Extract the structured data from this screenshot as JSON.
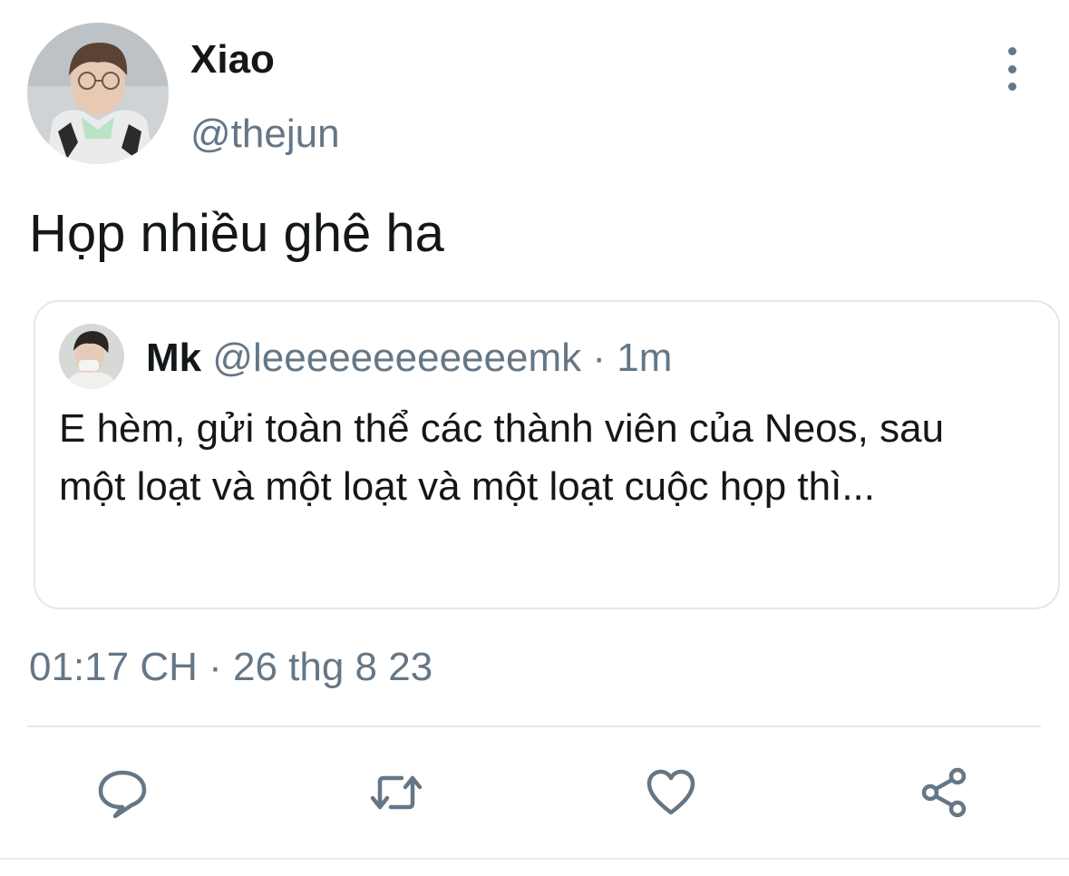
{
  "author": {
    "name": "Xiao",
    "handle": "@thejun",
    "avatar_icon": "profile-photo"
  },
  "tweet": {
    "text": "Họp nhiều ghê ha",
    "timestamp": "01:17 CH · 26 thg 8 23"
  },
  "quoted": {
    "name": "Mk",
    "handle": "@leeeeeeeeeeeemk",
    "separator": "·",
    "time": "1m",
    "text": "E hèm, gửi toàn thể các thành viên của Neos, sau một loạt và một loạt và một loạt cuộc họp thì...",
    "avatar_icon": "profile-photo"
  },
  "actions": [
    {
      "name": "reply",
      "icon": "comment-bubble-icon"
    },
    {
      "name": "retweet",
      "icon": "retweet-icon"
    },
    {
      "name": "like",
      "icon": "heart-icon"
    },
    {
      "name": "share",
      "icon": "share-icon"
    }
  ],
  "colors": {
    "text_primary": "#14171a",
    "text_secondary": "#657786",
    "border": "#e1e8ed"
  }
}
